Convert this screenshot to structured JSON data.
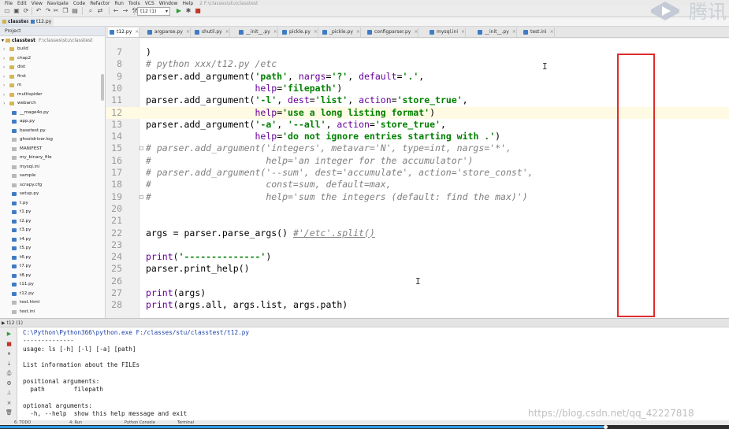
{
  "menubar": {
    "items": [
      "File",
      "Edit",
      "View",
      "Navigate",
      "Code",
      "Refactor",
      "Run",
      "Tools",
      "VCS",
      "Window",
      "Help"
    ],
    "title_bleed": "2 F:\\classes\\stu\\classtest"
  },
  "toolbar": {
    "run_config": "t12 (1)",
    "icons": [
      "open-icon",
      "save-icon",
      "sync-icon",
      "undo-icon",
      "redo-icon",
      "cut-icon",
      "copy-icon",
      "paste-icon",
      "find-icon",
      "replace-icon",
      "back-icon",
      "forward-icon",
      "build-icon",
      "run-icon",
      "debug-icon",
      "stop-icon"
    ]
  },
  "breadcrumb": {
    "root": "classtest",
    "file": "t12.py"
  },
  "project": {
    "header": "Project",
    "root_name": "classtest",
    "root_path": "F:\\classes\\stu\\classtest",
    "items": [
      {
        "label": "build",
        "kind": "folder"
      },
      {
        "label": "chap2",
        "kind": "folder"
      },
      {
        "label": "dist",
        "kind": "folder"
      },
      {
        "label": "first",
        "kind": "folder"
      },
      {
        "label": "m",
        "kind": "folder"
      },
      {
        "label": "multispider",
        "kind": "folder"
      },
      {
        "label": "webarch",
        "kind": "folder"
      },
      {
        "label": "__mage4o.py",
        "kind": "py"
      },
      {
        "label": "app.py",
        "kind": "py"
      },
      {
        "label": "basetest.py",
        "kind": "py"
      },
      {
        "label": "ghostdriver.log",
        "kind": "file"
      },
      {
        "label": "MANIFEST",
        "kind": "file"
      },
      {
        "label": "my_binary_file",
        "kind": "file"
      },
      {
        "label": "mysql.ini",
        "kind": "file"
      },
      {
        "label": "sample",
        "kind": "file"
      },
      {
        "label": "scrapy.cfg",
        "kind": "file"
      },
      {
        "label": "setup.py",
        "kind": "py"
      },
      {
        "label": "t.py",
        "kind": "py"
      },
      {
        "label": "t1.py",
        "kind": "py"
      },
      {
        "label": "t2.py",
        "kind": "py"
      },
      {
        "label": "t3.py",
        "kind": "py"
      },
      {
        "label": "t4.py",
        "kind": "py"
      },
      {
        "label": "t5.py",
        "kind": "py"
      },
      {
        "label": "t6.py",
        "kind": "py"
      },
      {
        "label": "t7.py",
        "kind": "py"
      },
      {
        "label": "t8.py",
        "kind": "py"
      },
      {
        "label": "t11.py",
        "kind": "py"
      },
      {
        "label": "t12.py",
        "kind": "py"
      },
      {
        "label": "test.html",
        "kind": "file"
      },
      {
        "label": "test.ini",
        "kind": "file"
      }
    ]
  },
  "tabs": [
    {
      "label": "t12.py",
      "active": true
    },
    {
      "label": "argparse.py",
      "active": false
    },
    {
      "label": "shutil.py",
      "active": false
    },
    {
      "label": "__init__.py",
      "active": false
    },
    {
      "label": "pickle.py",
      "active": false
    },
    {
      "label": "_pickle.py",
      "active": false
    },
    {
      "label": "configparser.py",
      "active": false
    },
    {
      "label": "mysql.ini",
      "active": false
    },
    {
      "label": "__init__.py",
      "active": false
    },
    {
      "label": "test.ini",
      "active": false
    }
  ],
  "editor": {
    "current_line": 12,
    "lines": [
      {
        "n": "7",
        "segs": [
          {
            "t": ")",
            "c": ""
          }
        ]
      },
      {
        "n": "8",
        "segs": [
          {
            "t": "# python xxx/t12.py /etc",
            "c": "com"
          }
        ]
      },
      {
        "n": "9",
        "segs": [
          {
            "t": "parser.add_argument(",
            "c": ""
          },
          {
            "t": "'path'",
            "c": "str"
          },
          {
            "t": ", ",
            "c": ""
          },
          {
            "t": "nargs",
            "c": "kw"
          },
          {
            "t": "=",
            "c": ""
          },
          {
            "t": "'?'",
            "c": "str"
          },
          {
            "t": ", ",
            "c": ""
          },
          {
            "t": "default",
            "c": "kw"
          },
          {
            "t": "=",
            "c": ""
          },
          {
            "t": "'.'",
            "c": "str"
          },
          {
            "t": ",",
            "c": ""
          }
        ]
      },
      {
        "n": "10",
        "segs": [
          {
            "t": "                    ",
            "c": ""
          },
          {
            "t": "help",
            "c": "kw"
          },
          {
            "t": "=",
            "c": ""
          },
          {
            "t": "'filepath'",
            "c": "str"
          },
          {
            "t": ")",
            "c": ""
          }
        ]
      },
      {
        "n": "11",
        "segs": [
          {
            "t": "parser.add_argument(",
            "c": ""
          },
          {
            "t": "'-l'",
            "c": "str"
          },
          {
            "t": ", ",
            "c": ""
          },
          {
            "t": "dest",
            "c": "kw"
          },
          {
            "t": "=",
            "c": ""
          },
          {
            "t": "'list'",
            "c": "str"
          },
          {
            "t": ", ",
            "c": ""
          },
          {
            "t": "action",
            "c": "kw"
          },
          {
            "t": "=",
            "c": ""
          },
          {
            "t": "'store_true'",
            "c": "str"
          },
          {
            "t": ",",
            "c": ""
          }
        ]
      },
      {
        "n": "12",
        "segs": [
          {
            "t": "                    ",
            "c": ""
          },
          {
            "t": "help",
            "c": "kw"
          },
          {
            "t": "=",
            "c": ""
          },
          {
            "t": "'use a long listing format'",
            "c": "str"
          },
          {
            "t": ")",
            "c": ""
          }
        ]
      },
      {
        "n": "13",
        "segs": [
          {
            "t": "parser.add_argument(",
            "c": ""
          },
          {
            "t": "'-a'",
            "c": "str"
          },
          {
            "t": ", ",
            "c": ""
          },
          {
            "t": "'--all'",
            "c": "str"
          },
          {
            "t": ", ",
            "c": ""
          },
          {
            "t": "action",
            "c": "kw"
          },
          {
            "t": "=",
            "c": ""
          },
          {
            "t": "'store_true'",
            "c": "str"
          },
          {
            "t": ",",
            "c": ""
          }
        ]
      },
      {
        "n": "14",
        "segs": [
          {
            "t": "                    ",
            "c": ""
          },
          {
            "t": "help",
            "c": "kw"
          },
          {
            "t": "=",
            "c": ""
          },
          {
            "t": "'do not ignore entries starting with .'",
            "c": "str"
          },
          {
            "t": ")",
            "c": ""
          }
        ]
      },
      {
        "n": "15",
        "segs": [
          {
            "t": "# parser.add_argument('integers', metavar='N', type=int, nargs='*',",
            "c": "com"
          }
        ]
      },
      {
        "n": "16",
        "segs": [
          {
            "t": "#                     help='an integer for the accumulator')",
            "c": "com"
          }
        ]
      },
      {
        "n": "17",
        "segs": [
          {
            "t": "# parser.add_argument('--sum', dest='accumulate', action='store_const',",
            "c": "com"
          }
        ]
      },
      {
        "n": "18",
        "segs": [
          {
            "t": "#                     const=sum, default=max,",
            "c": "com"
          }
        ]
      },
      {
        "n": "19",
        "segs": [
          {
            "t": "#                     help='sum the integers (default: find the max)')",
            "c": "com"
          }
        ]
      },
      {
        "n": "20",
        "segs": []
      },
      {
        "n": "21",
        "segs": []
      },
      {
        "n": "22",
        "segs": [
          {
            "t": "args = parser.parse_args() ",
            "c": ""
          },
          {
            "t": "#'/etc'.split()",
            "c": "dot"
          }
        ]
      },
      {
        "n": "23",
        "segs": []
      },
      {
        "n": "24",
        "segs": [
          {
            "t": "print",
            "c": "kw"
          },
          {
            "t": "(",
            "c": ""
          },
          {
            "t": "'--------------'",
            "c": "str"
          },
          {
            "t": ")",
            "c": ""
          }
        ]
      },
      {
        "n": "25",
        "segs": [
          {
            "t": "parser.print_help()",
            "c": ""
          }
        ]
      },
      {
        "n": "26",
        "segs": []
      },
      {
        "n": "27",
        "segs": [
          {
            "t": "print",
            "c": "kw"
          },
          {
            "t": "(args)",
            "c": ""
          }
        ]
      },
      {
        "n": "28",
        "segs": [
          {
            "t": "print",
            "c": "kw"
          },
          {
            "t": "(args.all, args.list, args.path)",
            "c": ""
          }
        ]
      }
    ]
  },
  "run": {
    "header": "t12 (1)",
    "lines": [
      "C:\\Python\\Python366\\python.exe F:/classes/stu/classtest/t12.py",
      "--------------",
      "usage: ls [-h] [-l] [-a] [path]",
      "",
      "List information about the FILEs",
      "",
      "positional arguments:",
      "  path        filepath",
      "",
      "optional arguments:",
      "  -h, --help  show this help message and exit"
    ],
    "side_icons": [
      "rerun-icon",
      "stop-icon",
      "pause-icon",
      "scroll-icon",
      "print-icon",
      "settings-icon",
      "pin-icon",
      "close-icon",
      "trash-icon"
    ]
  },
  "bottom_tools": [
    "6: TODO",
    "4: Run",
    "Python Console",
    "Terminal"
  ],
  "watermark": "https://blog.csdn.net/qq_42227818",
  "logo_text": "腾讯",
  "video": {
    "progress": 0.83
  },
  "colors": {
    "string": "#008000",
    "keyword": "#660099",
    "comment": "#808080",
    "highlight_line": "#fffae3",
    "annotation_box": "#e02b2b"
  }
}
